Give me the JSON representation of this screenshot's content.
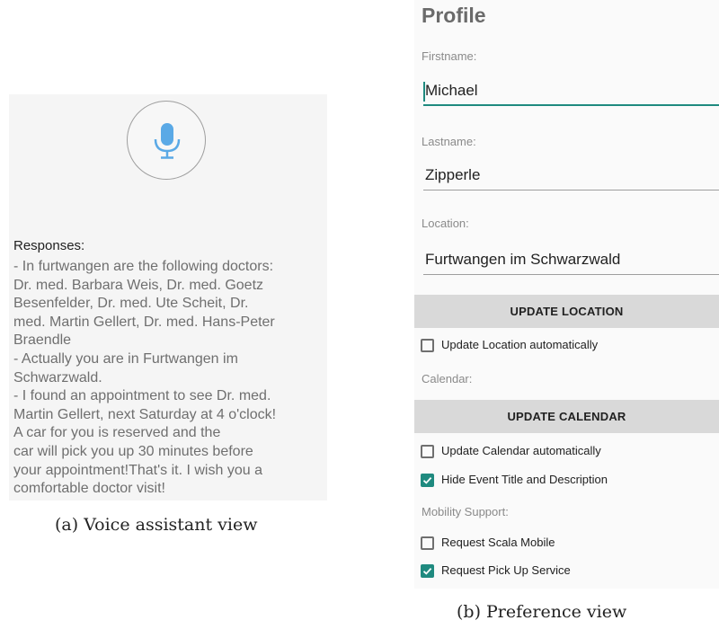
{
  "voice_assistant": {
    "mic_icon": "microphone-icon",
    "responses_label": "Responses:",
    "responses_lines": [
      "- In furtwangen are the following doctors:",
      "Dr. med. Barbara Weis, Dr. med. Goetz",
      "Besenfelder, Dr. med. Ute Scheit, Dr.",
      "med. Martin Gellert, Dr. med. Hans-Peter",
      "Braendle",
      "- Actually you are in Furtwangen im",
      "Schwarzwald.",
      "- I found an appointment to see Dr. med.",
      "Martin Gellert, next Saturday at 4 o'clock!",
      "A car for you is reserved and the",
      "car will pick you up 30 minutes before",
      "your appointment!That's it. I wish you a",
      "comfortable doctor visit!"
    ],
    "caption": "(a) Voice assistant view"
  },
  "preferences": {
    "title": "Profile",
    "firstname_label": "Firstname:",
    "firstname_value": "Michael",
    "lastname_label": "Lastname:",
    "lastname_value": "Zipperle",
    "location_label": "Location:",
    "location_value": "Furtwangen im Schwarzwald",
    "update_location_button": "UPDATE LOCATION",
    "update_location_auto": {
      "label": "Update Location automatically",
      "checked": false
    },
    "calendar_label": "Calendar:",
    "update_calendar_button": "UPDATE CALENDAR",
    "update_calendar_auto": {
      "label": "Update Calendar automatically",
      "checked": false
    },
    "hide_event": {
      "label": "Hide Event Title and Description",
      "checked": true
    },
    "mobility_label": "Mobility Support:",
    "request_scala": {
      "label": "Request Scala Mobile",
      "checked": false
    },
    "request_pickup": {
      "label": "Request Pick Up Service",
      "checked": true
    },
    "caption": "(b) Preference view"
  },
  "colors": {
    "accent": "#1f8a7f",
    "mic": "#5aa9e6",
    "button_bg": "#d9d9d9"
  }
}
